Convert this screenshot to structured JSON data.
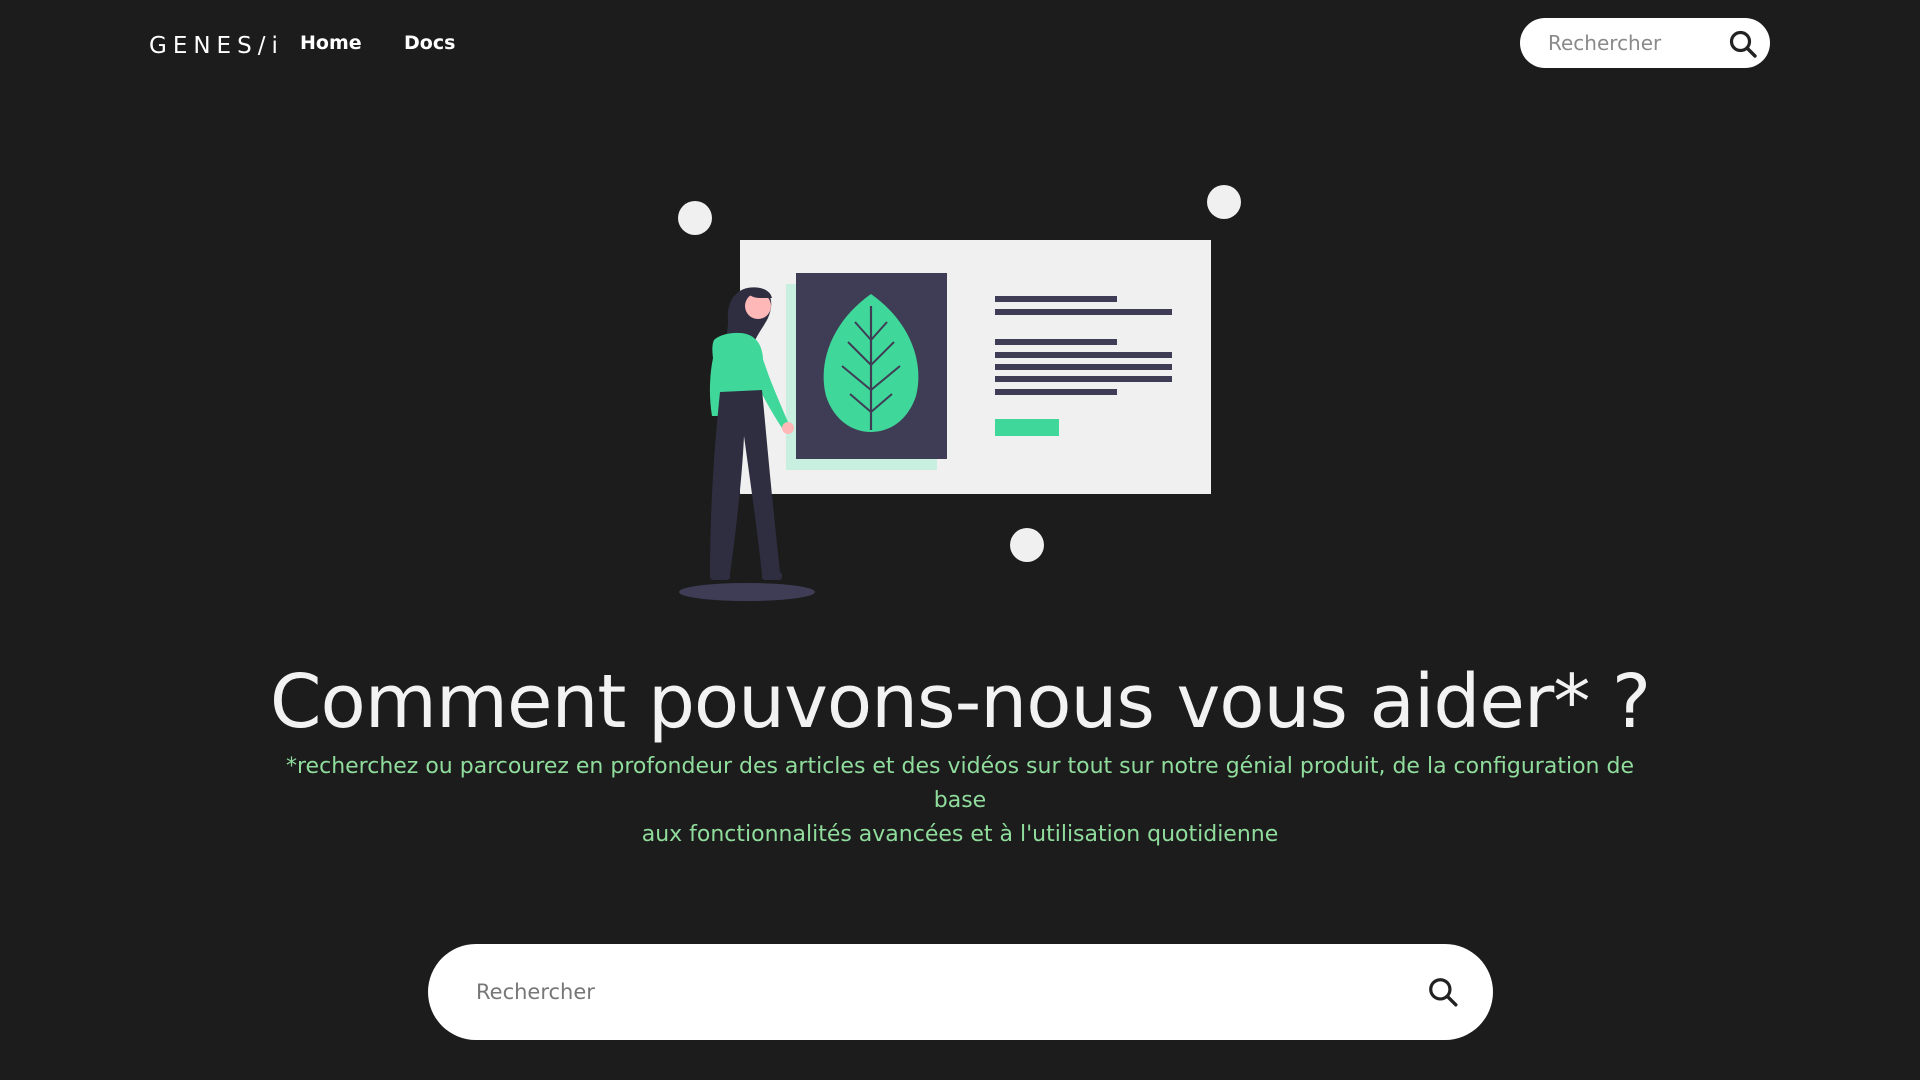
{
  "header": {
    "logo_text": "GENES/i",
    "nav": {
      "home_label": "Home",
      "docs_label": "Docs"
    },
    "search": {
      "placeholder": "Rechercher"
    }
  },
  "hero": {
    "title": "Comment pouvons-nous vous aider* ?",
    "subtitle_line1": "*recherchez ou parcourez en profondeur des articles et des vidéos sur tout sur notre génial produit, de la configuration de base",
    "subtitle_line2": "aux fonctionnalités avancées et à l'utilisation quotidienne"
  },
  "main_search": {
    "placeholder": "Rechercher"
  },
  "icons": {
    "header_search": "search-icon",
    "main_search": "search-icon",
    "illustration": "woman-presenting-leaf-illustration"
  },
  "colors": {
    "background": "#1c1c1c",
    "accent_green": "#3fd89a",
    "subtitle_green": "#8fdc9c",
    "panel_dark": "#3f3d56"
  }
}
